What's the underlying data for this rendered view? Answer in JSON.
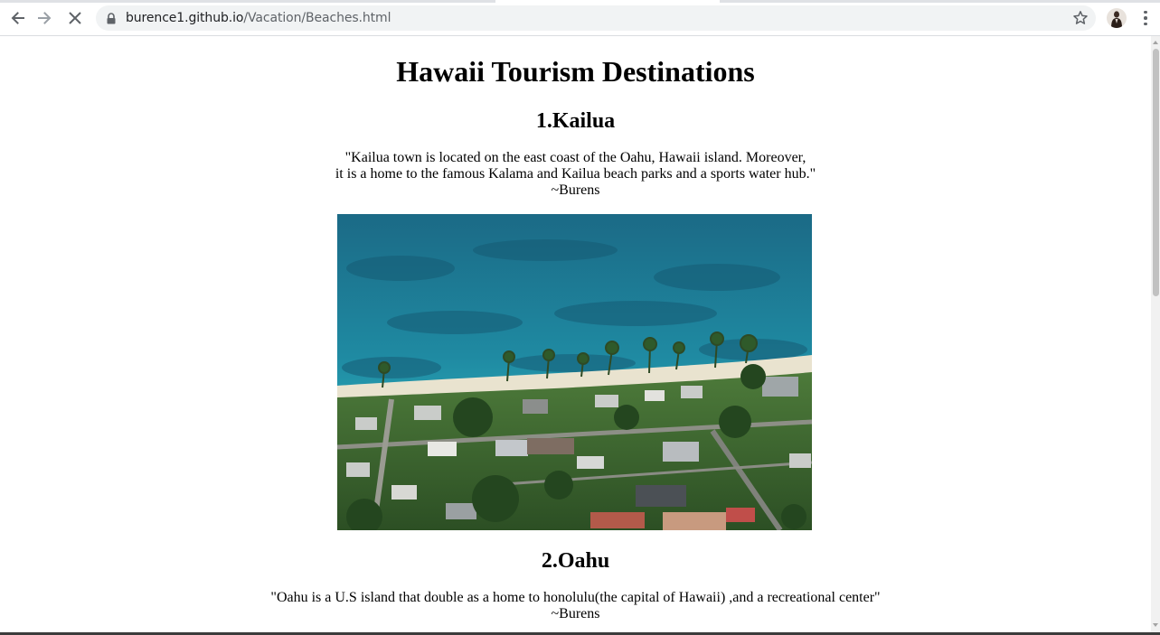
{
  "browser": {
    "url_host": "burence1.github.io",
    "url_path": "/Vacation/Beaches.html",
    "icons": {
      "back": "arrow-left-icon",
      "forward": "arrow-right-icon",
      "stop": "close-icon",
      "lock": "lock-icon",
      "bookmark": "star-icon",
      "menu": "kebab-menu-icon"
    }
  },
  "page": {
    "title": "Hawaii Tourism Destinations",
    "sections": [
      {
        "heading": "1.Kailua",
        "quote_lines": [
          "\"Kailua town is located on the east coast of the Oahu, Hawaii island. Moreover,",
          "it is a home to the famous Kalama and Kailua beach parks and a sports water hub.\""
        ],
        "author": "~Burens"
      },
      {
        "heading": "2.Oahu",
        "quote_lines": [
          "\"Oahu is a U.S island that double as a home to honolulu(the capital of Hawaii) ,and a recreational center\""
        ],
        "author": "~Burens"
      }
    ]
  },
  "colors": {
    "chrome_bg": "#ffffff",
    "omnibox_bg": "#f1f3f4",
    "icon_gray": "#5f6368",
    "ocean_deep": "#1f6f8a",
    "ocean_shallow": "#2fb4bf"
  }
}
